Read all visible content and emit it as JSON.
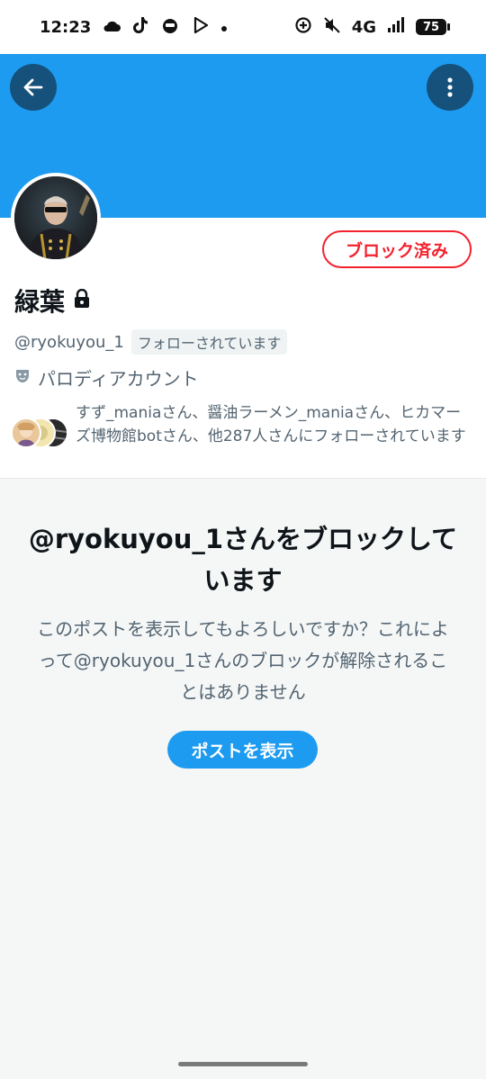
{
  "status_bar": {
    "time": "12:23",
    "network": "4G",
    "battery": "75"
  },
  "profile": {
    "name": "緑葉",
    "handle": "@ryokuyou_1",
    "follows_you": "フォローされています",
    "parody_label": "パロディアカウント",
    "blocked_button": "ブロック済み",
    "followed_by": "すず_maniaさん、醤油ラーメン_maniaさん、ヒカマーズ博物館botさん、他287人さんにフォローされています"
  },
  "notice": {
    "title": "@ryokuyou_1さんをブロックしています",
    "body": "このポストを表示してもよろしいですか？これによって@ryokuyou_1さんのブロックが解除されることはありません",
    "show_button": "ポストを表示"
  },
  "colors": {
    "accent": "#1d9bf0",
    "blocked_red": "#f4212e",
    "secondary_text": "#536471"
  }
}
